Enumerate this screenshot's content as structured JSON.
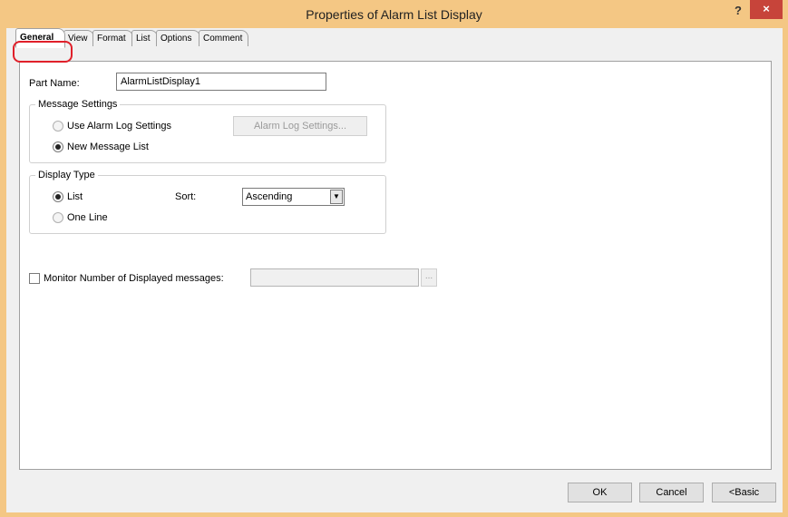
{
  "window": {
    "title": "Properties of Alarm List Display",
    "help_label": "?",
    "close_label": "×"
  },
  "tabs": [
    {
      "label": "General",
      "active": true
    },
    {
      "label": "View"
    },
    {
      "label": "Format"
    },
    {
      "label": "List"
    },
    {
      "label": "Options"
    },
    {
      "label": "Comment"
    }
  ],
  "general": {
    "part_name_label": "Part Name:",
    "part_name_value": "AlarmListDisplay1",
    "message_settings": {
      "title": "Message Settings",
      "use_alarm_log_label": "Use Alarm Log Settings",
      "alarm_log_button": "Alarm Log Settings...",
      "new_message_list_label": "New Message List",
      "selected": "New Message List"
    },
    "display_type": {
      "title": "Display Type",
      "list_label": "List",
      "one_line_label": "One Line",
      "selected": "List",
      "sort_label": "Sort:",
      "sort_value": "Ascending"
    },
    "monitor": {
      "label": "Monitor Number of Displayed messages:",
      "checked": false,
      "value": "",
      "browse_label": "..."
    }
  },
  "footer": {
    "ok_label": "OK",
    "cancel_label": "Cancel",
    "basic_label": "<Basic"
  },
  "colors": {
    "title_bar": "#f4c784",
    "close_button": "#c7443a",
    "tab_highlight": "#e0202a"
  }
}
